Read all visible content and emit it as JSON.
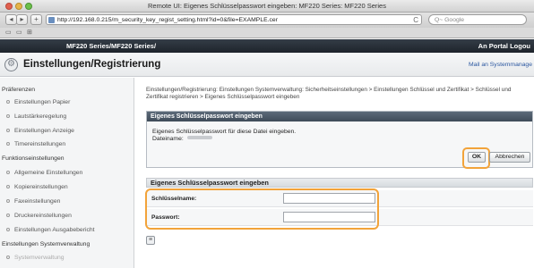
{
  "window": {
    "title": "Remote UI: Eigenes Schlüsselpasswort eingeben: MF220 Series: MF220 Series"
  },
  "browser": {
    "url": "http://192.168.0.215/m_security_key_regist_setting.html?id=0&file=EXAMPLE.cer",
    "search_placeholder": "Q~ Google",
    "reload_glyph": "C",
    "back_glyph": "◂",
    "forward_glyph": "▸",
    "add_glyph": "+",
    "bookmarks_glyphs": [
      "▭",
      "▭",
      "⊞"
    ]
  },
  "app": {
    "brand": "MF220 Series/MF220 Series/",
    "portal_link": "An Portal  Logou",
    "page_title": "Einstellungen/Registrierung",
    "mail_admin": "Mail an Systemmanage"
  },
  "sidebar": {
    "sections": [
      {
        "label": "Präferenzen",
        "items": [
          "Einstellungen Papier",
          "Lautstärkeregelung",
          "Einstellungen Anzeige",
          "Timereinstellungen"
        ]
      },
      {
        "label": "Funktionseinstellungen",
        "items": [
          "Allgemeine Einstellungen",
          "Kopiereinstellungen",
          "Faxeinstellungen",
          "Druckereinstellungen",
          "Einstellungen Ausgabebericht"
        ]
      },
      {
        "label": "Einstellungen Systemverwaltung",
        "items": [
          "Systemverwaltung"
        ]
      }
    ]
  },
  "main": {
    "breadcrumb": "Einstellungen/Registrierung: Einstellungen Systemverwaltung: Sicherheitseinstellungen > Einstellungen Schlüssel und Zertifikat > Schlüssel und Zertifikat registrieren > Eigenes Schlüsselpasswort eingeben",
    "panel_title": "Eigenes Schlüsselpasswort eingeben",
    "panel_message": "Eigenes Schlüsselpasswort für diese Datei eingeben.",
    "file_label": "Dateiname:",
    "ok_label": "OK",
    "cancel_label": "Abbrechen",
    "section_title": "Eigenes Schlüsselpasswort eingeben",
    "fields": [
      {
        "label": "Schlüsselname:",
        "value": ""
      },
      {
        "label": "Passwort:",
        "value": ""
      }
    ],
    "footer_glyph": "≡"
  },
  "colors": {
    "highlight": "#f2a33a",
    "header_dark": "#1e242b",
    "panel_head": "#4d5a68"
  }
}
